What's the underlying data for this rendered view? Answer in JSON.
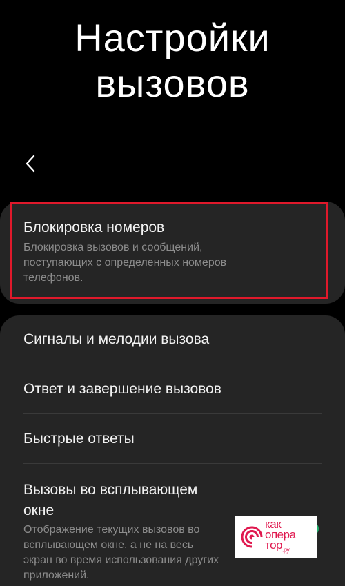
{
  "header": {
    "title_line1": "Настройки",
    "title_line2": "вызовов"
  },
  "back": {
    "icon": "chevron-left-icon"
  },
  "block_numbers": {
    "title": "Блокировка номеров",
    "description_lines": [
      "Блокировка вызовов и сообщений,",
      "поступающих с определенных номеров",
      "телефонов."
    ]
  },
  "settings_list": {
    "items": [
      {
        "label": "Сигналы и мелодии вызова"
      },
      {
        "label": "Ответ и завершение вызовов"
      },
      {
        "label": "Быстрые ответы"
      },
      {
        "label_lines": [
          "Вызовы во всплывающем",
          "окне"
        ],
        "description_lines": [
          "Отображение текущих вызовов во",
          "всплывающем окне, а не на весь",
          "экран во время использования других",
          "приложений."
        ]
      }
    ]
  },
  "watermark": {
    "line1": "как",
    "line2": "опера",
    "line3": "тор",
    "suffix": ".ру"
  },
  "colors": {
    "background": "#000000",
    "card": "#252525",
    "highlight": "#e0192b",
    "secondary_text": "#8c8c8c",
    "watermark_accent": "#e0194f",
    "toggle_on": "#1faf6b"
  }
}
